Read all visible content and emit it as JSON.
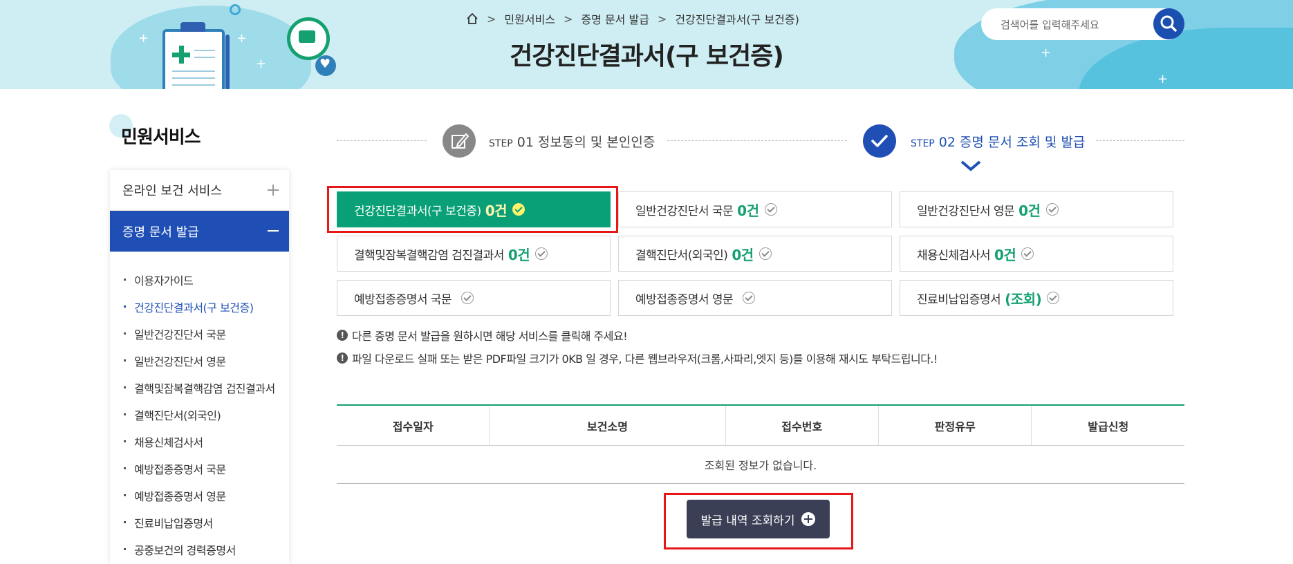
{
  "breadcrumb": {
    "home_icon": "home-icon",
    "items": [
      "민원서비스",
      "증명 문서 발급",
      "건강진단결과서(구 보건증)"
    ]
  },
  "page_title": "건강진단결과서(구 보건증)",
  "search": {
    "placeholder": "검색어를 입력해주세요",
    "icon": "search-icon"
  },
  "sidebar": {
    "title": "민원서비스",
    "categories": [
      {
        "label": "온라인 보건 서비스",
        "toggle": "+"
      },
      {
        "label": "증명 문서 발급",
        "toggle": "−"
      }
    ],
    "items": [
      "이용자가이드",
      "건강진단결과서(구 보건증)",
      "일반건강진단서 국문",
      "일반건강진단서 영문",
      "결핵및잠복결핵감염 검진결과서",
      "결핵진단서(외국인)",
      "채용신체검사서",
      "예방접종증명서 국문",
      "예방접종증명서 영문",
      "진료비납입증명서",
      "공중보건의 경력증명서"
    ],
    "active_index": 1
  },
  "steps": [
    {
      "word": "STEP",
      "num": "01",
      "label": "정보동의 및 본인인증",
      "icon": "pencil-edit-icon"
    },
    {
      "word": "STEP",
      "num": "02",
      "label": "증명 문서 조회 및 발급",
      "icon": "check-icon"
    }
  ],
  "services": [
    {
      "label": "건강진단결과서(구 보건증)",
      "count": "0건",
      "selected": true
    },
    {
      "label": "일반건강진단서 국문",
      "count": "0건"
    },
    {
      "label": "일반건강진단서 영문",
      "count": "0건"
    },
    {
      "label": "결핵및잠복결핵감염 검진결과서",
      "count": "0건"
    },
    {
      "label": "결핵진단서(외국인)",
      "count": "0건"
    },
    {
      "label": "채용신체검사서",
      "count": "0건"
    },
    {
      "label": "예방접종증명서 국문",
      "count": ""
    },
    {
      "label": "예방접종증명서 영문",
      "count": ""
    },
    {
      "label": "진료비납입증명서",
      "count": "(조회)"
    }
  ],
  "notices": [
    "다른 증명 문서 발급을 원하시면 해당 서비스를 클릭해 주세요!",
    "파일 다운로드 실패 또는 받은 PDF파일 크기가 0KB 일 경우, 다른 웹브라우저(크롬,사파리,엣지 등)를 이용해 재시도 부탁드립니다.!"
  ],
  "table": {
    "headers": [
      "접수일자",
      "보건소명",
      "접수번호",
      "판정유무",
      "발급신청"
    ],
    "empty_message": "조회된 정보가 없습니다."
  },
  "history_button": {
    "label": "발급 내역 조회하기",
    "icon": "plus-circle-icon"
  },
  "colors": {
    "primary_blue": "#1f4fb4",
    "accent_green": "#0aa077",
    "highlight_red": "#e81717",
    "banner_bg": "#cfeef3"
  }
}
